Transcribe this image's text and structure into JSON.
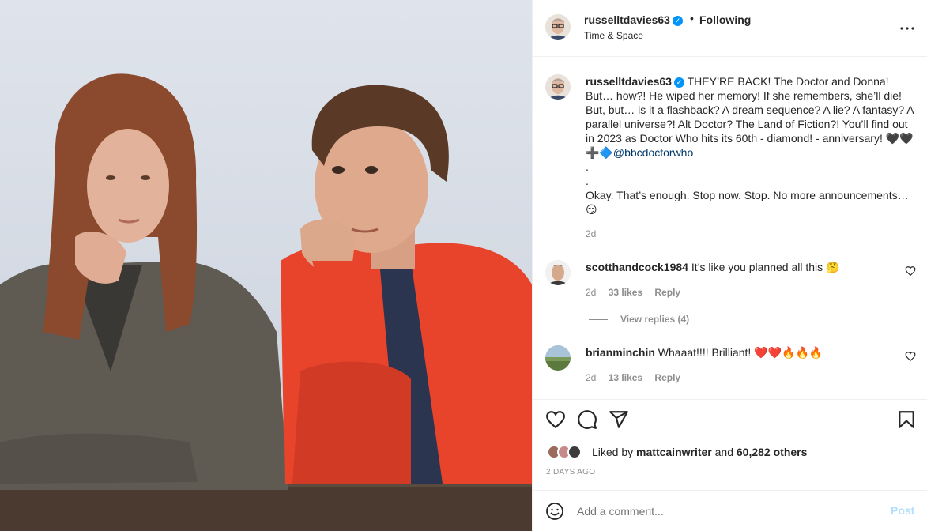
{
  "post": {
    "username": "russelltdavies63",
    "verified": true,
    "separator": "•",
    "follow_state": "Following",
    "subtitle": "Time & Space",
    "more_icon": "more-horizontal-icon"
  },
  "caption": {
    "username": "russelltdavies63",
    "text": "THEY’RE BACK! The Doctor and Donna! But… how?! He wiped her memory! If she remembers, she’ll die! But, but… is it a flashback? A dream sequence? A lie? A fantasy? A parallel universe?! Alt Doctor? The Land of Fiction?! You’ll find out in 2023 as Doctor Who hits its 60th - diamond! - anniversary! 🖤🖤➕🔷",
    "mention": "@bbcdoctorwho",
    "text_after": "\n.\n.\nOkay. That’s enough. Stop now. Stop. No more announcements…\n😏",
    "time": "2d"
  },
  "comments": [
    {
      "username": "scotthandcock1984",
      "text": "It’s like you planned all this 🤔",
      "time": "2d",
      "likes": "33 likes",
      "reply_label": "Reply",
      "view_replies": "View replies (4)"
    },
    {
      "username": "brianminchin",
      "text": "Whaaat!!!! Brilliant! ❤️❤️🔥🔥🔥",
      "time": "2d",
      "likes": "13 likes",
      "reply_label": "Reply"
    }
  ],
  "actions": {
    "icons": [
      "heart-icon",
      "comment-icon",
      "share-icon",
      "bookmark-icon"
    ]
  },
  "likes": {
    "prefix": "Liked by",
    "user": "mattcainwriter",
    "conjunction": "and",
    "others": "60,282 others"
  },
  "posted_ago": "2 DAYS AGO",
  "add_comment": {
    "placeholder": "Add a comment...",
    "post_label": "Post"
  },
  "colors": {
    "accent": "#0095f6",
    "muted": "#8e8e8e",
    "post_disabled": "#b2dffc",
    "mention": "#00376b"
  }
}
